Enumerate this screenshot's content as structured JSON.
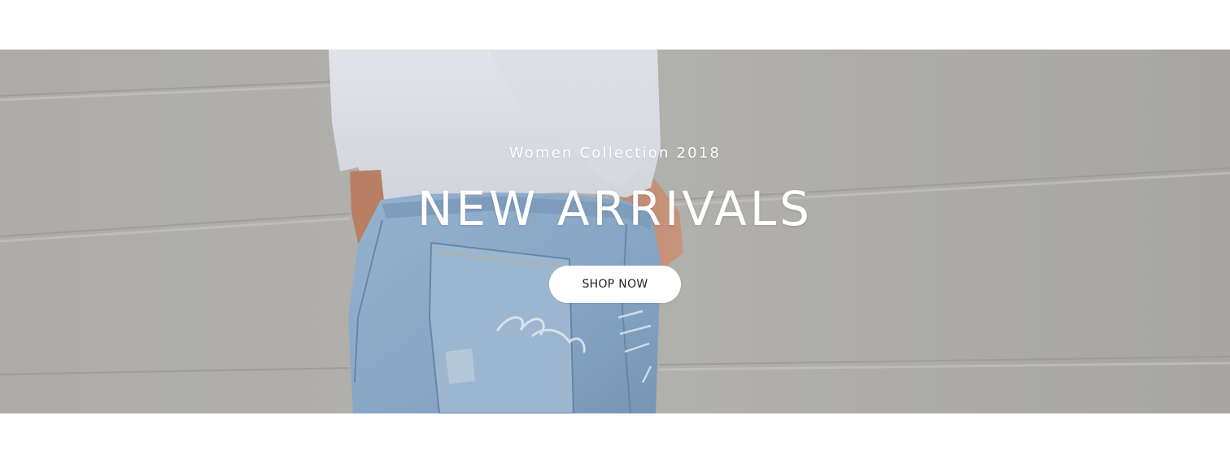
{
  "hero": {
    "eyebrow": "Women Collection 2018",
    "headline": "NEW ARRIVALS",
    "button_label": "SHOP NOW"
  },
  "colors": {
    "page_background": "#ffffff",
    "wall": "#b9b8b4",
    "denim": "#8fb0d2",
    "shirt": "#eef0f7",
    "skin": "#c78d70",
    "button_background": "#ffffff",
    "button_text": "#222222"
  },
  "image": {
    "subject": "woman in white t-shirt and light denim jeans standing against a grey concrete wall"
  }
}
